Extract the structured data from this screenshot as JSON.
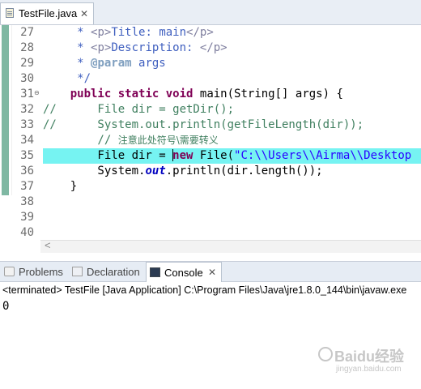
{
  "editor_tab": {
    "title": "TestFile.java",
    "close": "✕"
  },
  "code": {
    "lines": [
      {
        "num": "27",
        "segments": [
          {
            "t": "     * ",
            "c": "jd"
          },
          {
            "t": "<p>",
            "c": "tag"
          },
          {
            "t": "Title: main",
            "c": "jd"
          },
          {
            "t": "</p>",
            "c": "tag"
          }
        ]
      },
      {
        "num": "28",
        "segments": [
          {
            "t": "     * ",
            "c": "jd"
          },
          {
            "t": "<p>",
            "c": "tag"
          },
          {
            "t": "Description: ",
            "c": "jd"
          },
          {
            "t": "</p>",
            "c": "tag"
          }
        ]
      },
      {
        "num": "29",
        "segments": [
          {
            "t": "     * ",
            "c": "jd"
          },
          {
            "t": "@param",
            "c": "jdkw"
          },
          {
            "t": " args",
            "c": "jd"
          }
        ]
      },
      {
        "num": "30",
        "segments": [
          {
            "t": "     */",
            "c": "jd"
          }
        ]
      },
      {
        "num": "31",
        "fold": "⊖",
        "segments": [
          {
            "t": "    ",
            "c": ""
          },
          {
            "t": "public",
            "c": "kw"
          },
          {
            "t": " ",
            "c": ""
          },
          {
            "t": "static",
            "c": "kw"
          },
          {
            "t": " ",
            "c": ""
          },
          {
            "t": "void",
            "c": "kw"
          },
          {
            "t": " main(String[] args) {",
            "c": ""
          }
        ]
      },
      {
        "num": "32",
        "segments": [
          {
            "t": "//      File dir = getDir();",
            "c": "cm"
          }
        ]
      },
      {
        "num": "33",
        "segments": [
          {
            "t": "//      System.out.println(getFileLength(dir));",
            "c": "cm"
          }
        ]
      },
      {
        "num": "34",
        "segments": [
          {
            "t": "        // ",
            "c": "cm"
          },
          {
            "t": "注意此处符号\\需要转义",
            "c": "cm cn"
          }
        ]
      },
      {
        "num": "35",
        "highlight": true,
        "segments": [
          {
            "t": "        File dir = ",
            "c": ""
          },
          {
            "caret": true
          },
          {
            "t": "new",
            "c": "kw"
          },
          {
            "t": " File(",
            "c": ""
          },
          {
            "t": "\"C:\\\\Users\\\\Airma\\\\Desktop",
            "c": "str"
          }
        ]
      },
      {
        "num": "36",
        "segments": [
          {
            "t": "        System.",
            "c": ""
          },
          {
            "t": "out",
            "c": "fld"
          },
          {
            "t": ".println(dir.length());",
            "c": ""
          }
        ]
      },
      {
        "num": "37",
        "segments": [
          {
            "t": "    }",
            "c": ""
          }
        ]
      },
      {
        "num": "38",
        "segments": []
      },
      {
        "num": "39",
        "segments": []
      },
      {
        "num": "40",
        "segments": []
      }
    ]
  },
  "scroll": {
    "left_arrow": "<"
  },
  "panel_tabs": {
    "problems": "Problems",
    "declaration": "Declaration",
    "console": "Console",
    "close": "✕"
  },
  "console": {
    "header": "<terminated> TestFile [Java Application] C:\\Program Files\\Java\\jre1.8.0_144\\bin\\javaw.exe",
    "output": "0"
  },
  "watermark": {
    "main": "Baidu经验",
    "sub": "jingyan.baidu.com"
  }
}
